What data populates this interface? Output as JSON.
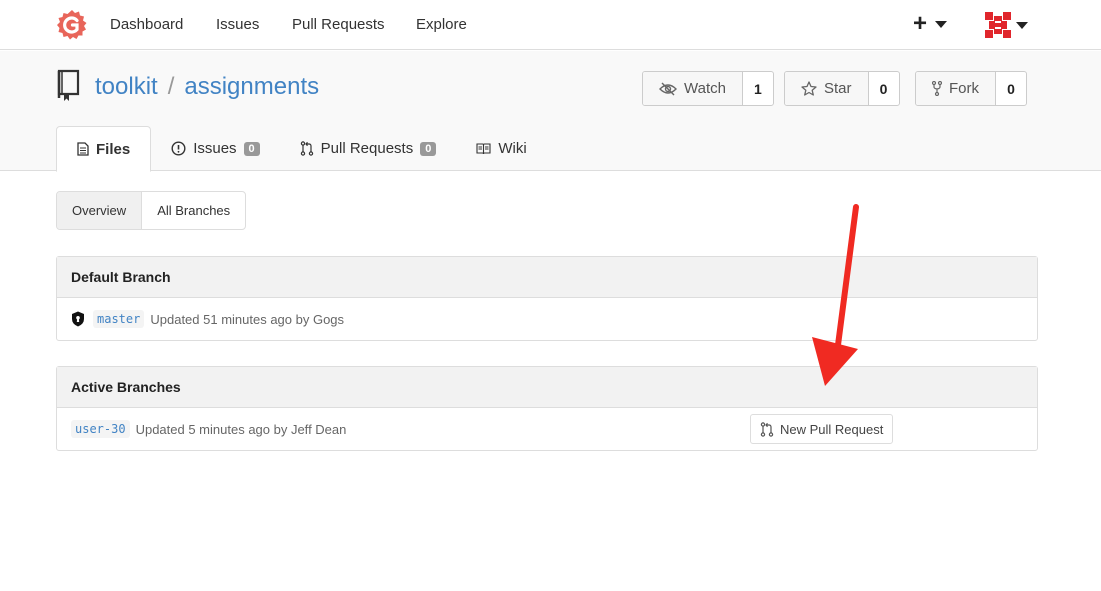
{
  "nav": {
    "links": [
      "Dashboard",
      "Issues",
      "Pull Requests",
      "Explore"
    ],
    "plus": "+"
  },
  "repo": {
    "owner": "toolkit",
    "separator": "/",
    "name": "assignments",
    "watch": {
      "label": "Watch",
      "count": "1"
    },
    "star": {
      "label": "Star",
      "count": "0"
    },
    "fork": {
      "label": "Fork",
      "count": "0"
    }
  },
  "tabs": [
    {
      "label": "Files",
      "icon": "file-text-icon"
    },
    {
      "label": "Issues",
      "badge": "0",
      "icon": "issue-icon"
    },
    {
      "label": "Pull Requests",
      "badge": "0",
      "icon": "pull-request-icon"
    },
    {
      "label": "Wiki",
      "icon": "book-icon"
    }
  ],
  "branch_nav": {
    "overview": "Overview",
    "all": "All Branches"
  },
  "default_branch": {
    "title": "Default Branch",
    "branch": "master",
    "updated": "Updated 51 minutes ago by Gogs"
  },
  "active_branches": {
    "title": "Active Branches",
    "rows": [
      {
        "branch": "user-30",
        "updated": "Updated 5 minutes ago by Jeff Dean",
        "button": "New Pull Request"
      }
    ]
  },
  "colors": {
    "link": "#4183c4",
    "logo": "#e8655a",
    "annotation_arrow": "#f02a22"
  }
}
